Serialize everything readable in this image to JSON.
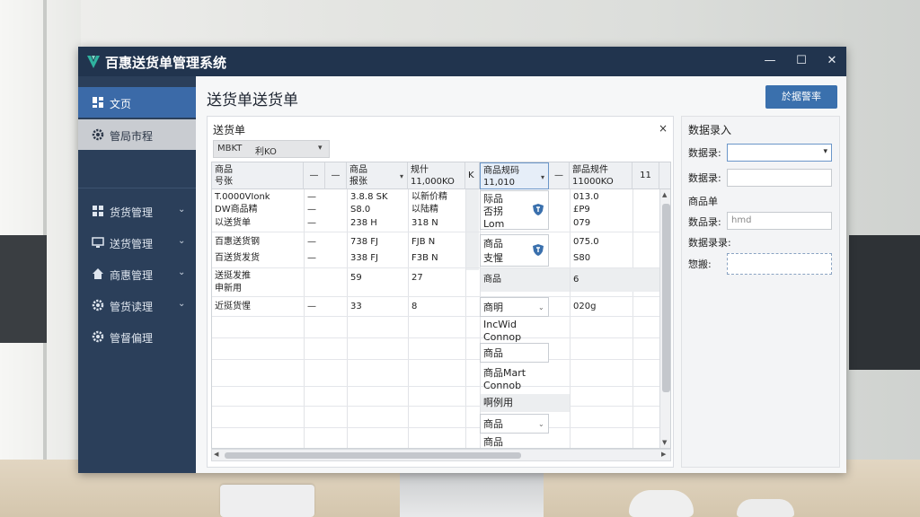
{
  "window": {
    "title": "百惠送货单管理系统",
    "controls": {
      "minimize": "—",
      "maximize": "☐",
      "close": "✕"
    }
  },
  "sidebar": {
    "items": [
      {
        "label": "文页",
        "icon": "dashboard-icon",
        "state": "active"
      },
      {
        "label": "管局市程",
        "icon": "gear-icon",
        "state": "selected"
      },
      {
        "label": "货货管理",
        "icon": "grid-icon",
        "chevron": "⌄"
      },
      {
        "label": "送货管理",
        "icon": "monitor-icon",
        "chevron": "⌄"
      },
      {
        "label": "商惠管理",
        "icon": "home-icon",
        "chevron": "⌄"
      },
      {
        "label": "管货读理",
        "icon": "gear-icon",
        "chevron": "⌄"
      },
      {
        "label": "管督偏理",
        "icon": "gear-icon"
      }
    ]
  },
  "main": {
    "page_title": "送货单送货单",
    "top_button": "於据警率",
    "panel": {
      "title": "送货单",
      "close": "×",
      "filter": {
        "label": "MBKT",
        "value": "利KO",
        "caret": "▾"
      }
    },
    "grid": {
      "headers": [
        {
          "line1": "商品",
          "line2": "号张",
          "caret": ""
        },
        {
          "line1": "—",
          "line2": "",
          "caret": ""
        },
        {
          "line1": "—",
          "line2": "",
          "caret": ""
        },
        {
          "line1": "商品",
          "line2": "报张",
          "caret": "▾"
        },
        {
          "line1": "规什",
          "line2": "11,000KO",
          "caret": ""
        },
        {
          "line1": "K",
          "line2": "",
          "caret": ""
        },
        {
          "line1": "商品规码",
          "line2": "11,010",
          "caret": "▾"
        },
        {
          "line1": "—",
          "line2": "",
          "caret": ""
        },
        {
          "line1": "部品规件",
          "line2": "11000KO",
          "caret": ""
        },
        {
          "line1": "11",
          "line2": "",
          "caret": ""
        }
      ],
      "rows": [
        {
          "c0": "T.0000VIonk",
          "c1": "—",
          "c3": "3.8.8  SK",
          "c4": "以新价精",
          "c6": "际品",
          "c8": "013.0"
        },
        {
          "c0": "DW商品精",
          "c1": "—",
          "c3": "S8.0",
          "c4": "以陆精",
          "c6": "否拐",
          "c8": "£P9"
        },
        {
          "c0": "以送货单",
          "c1": "—",
          "c3": "238  H",
          "c4": "318  N",
          "c6": "Lom",
          "c8": "079"
        },
        {
          "c0": "百惠送货钢",
          "c1": "—",
          "c3": "738  FJ",
          "c4": "FJB  N",
          "c6": "商品",
          "c8": "075.0"
        },
        {
          "c0": "百送货发货",
          "c1": "—",
          "c3": "338  FJ",
          "c4": "F3B  N",
          "c6": "支惺",
          "c8": "S80"
        },
        {
          "c0": "送挺发推",
          "c0b": "申新用",
          "c3": "59",
          "c4": "27",
          "c6": "商品",
          "c8": "6"
        },
        {
          "c0": "近挺货惺",
          "c1": "—",
          "c3": "33",
          "c4": "8",
          "c6": "商明",
          "c8": "020g"
        }
      ],
      "dropdown_items": [
        {
          "line1": "IncWid",
          "line2": "Connop"
        },
        {
          "line1": "商品",
          "line2": ""
        },
        {
          "line1": "商品Mart",
          "line2": "Connob"
        },
        {
          "line1": "啊例用",
          "line2": ""
        },
        {
          "line1": "商品",
          "line2": ""
        },
        {
          "line1": "商品",
          "line2": ""
        }
      ]
    },
    "side_panel": {
      "title": "数据录入",
      "fields": [
        {
          "label": "数据录:",
          "value": "",
          "type": "select"
        },
        {
          "label": "数据录:",
          "value": ""
        },
        {
          "label": "商品单",
          "value": null
        },
        {
          "label": "数品录:",
          "value": "hmd"
        },
        {
          "label": "数据录录:",
          "value": null
        },
        {
          "label": "惣搬:",
          "value": ""
        }
      ]
    }
  },
  "colors": {
    "titlebar": "#21344e",
    "sidebar": "#2b3f5a",
    "accent": "#3a70ad"
  }
}
